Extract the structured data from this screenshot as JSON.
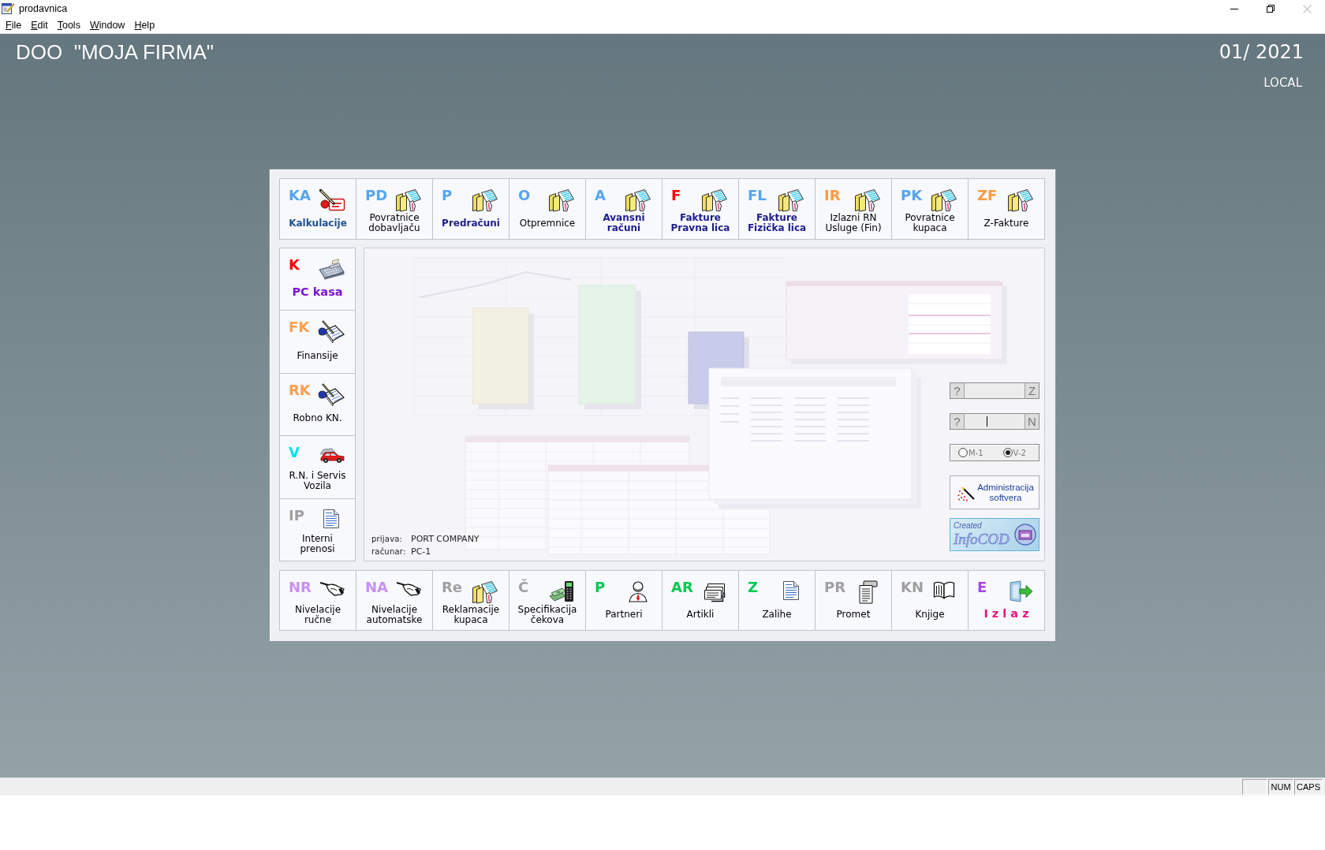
{
  "window": {
    "title": "prodavnica",
    "close_disabled": true
  },
  "menu": [
    "File",
    "Edit",
    "Tools",
    "Window",
    "Help"
  ],
  "header": {
    "company": "DOO  \"MOJA FIRMA\"",
    "period": "01/ 2021",
    "location": "LOCAL"
  },
  "top_modules": [
    {
      "code": "KA",
      "color": "#55a5f0",
      "kind": "pencil-card",
      "label": {
        "text": "Kalkulacije",
        "color": "#1e4f91"
      },
      "bold": true,
      "large": false
    },
    {
      "code": "PD",
      "color": "#55a5f0",
      "kind": "folder",
      "label": {
        "text": "Povratnice\ndobavljaču",
        "color": "#000000"
      },
      "bold": false,
      "large": false
    },
    {
      "code": "P",
      "color": "#55a5f0",
      "kind": "folder",
      "label": {
        "text": "Predračuni",
        "color": "#1c1c8c"
      },
      "bold": true,
      "large": false
    },
    {
      "code": "O",
      "color": "#55a5f0",
      "kind": "folder",
      "label": {
        "text": "Otpremnice",
        "color": "#000000"
      },
      "bold": false,
      "large": false
    },
    {
      "code": "A",
      "color": "#55a5f0",
      "kind": "folder",
      "label": {
        "text": "Avansni\nračuni",
        "color": "#1c1c8c"
      },
      "bold": true,
      "large": false
    },
    {
      "code": "F",
      "color": "#ff0000",
      "kind": "folder",
      "label": {
        "text": "Fakture\nPravna lica",
        "color": "#1c1c8c"
      },
      "bold": true,
      "large": false
    },
    {
      "code": "FL",
      "color": "#55a5f0",
      "kind": "folder",
      "label": {
        "text": "Fakture\nFizička lica",
        "color": "#1c1c8c"
      },
      "bold": true,
      "large": false
    },
    {
      "code": "IR",
      "color": "#ff9a40",
      "kind": "folder",
      "label": {
        "text": "Izlazni RN\nUsluge (Fin)",
        "color": "#000000"
      },
      "bold": false,
      "large": false
    },
    {
      "code": "PK",
      "color": "#55a5f0",
      "kind": "folder",
      "label": {
        "text": "Povratnice\nkupaca",
        "color": "#000000"
      },
      "bold": false,
      "large": false
    },
    {
      "code": "ZF",
      "color": "#ff9a40",
      "kind": "folder",
      "label": {
        "text": "Z-Fakture",
        "color": "#000000"
      },
      "bold": false,
      "large": false
    }
  ],
  "side_modules": [
    {
      "code": "K",
      "color": "#ff0000",
      "kind": "register",
      "label": {
        "text": "PC kasa",
        "color": "#7a14d2"
      },
      "bold": true,
      "large": true
    },
    {
      "code": "FK",
      "color": "#ffa050",
      "kind": "notepad",
      "label": {
        "text": "Finansije",
        "color": "#000000"
      },
      "bold": false,
      "large": false
    },
    {
      "code": "RK",
      "color": "#ffa050",
      "kind": "notepad",
      "label": {
        "text": "Robno KN.",
        "color": "#000000"
      },
      "bold": false,
      "large": false
    },
    {
      "code": "V",
      "color": "#00e4ee",
      "kind": "car",
      "label": {
        "text": "R.N. i Servis\nVozila",
        "color": "#000000"
      },
      "bold": false,
      "large": false
    },
    {
      "code": "IP",
      "color": "#a0a0a0",
      "kind": "document",
      "label": {
        "text": "Interni\nprenosi",
        "color": "#000000"
      },
      "bold": false,
      "large": false
    }
  ],
  "bottom_modules": [
    {
      "code": "NR",
      "color": "#c890f0",
      "kind": "hand-pen",
      "label": {
        "text": "Nivelacije\nručne",
        "color": "#000000"
      },
      "bold": false,
      "large": false
    },
    {
      "code": "NA",
      "color": "#c890f0",
      "kind": "hand-pen",
      "label": {
        "text": "Nivelacije\nautomatske",
        "color": "#000000"
      },
      "bold": false,
      "large": false
    },
    {
      "code": "Re",
      "color": "#a0a0a0",
      "kind": "folder",
      "label": {
        "text": "Reklamacije\nkupaca",
        "color": "#000000"
      },
      "bold": false,
      "large": false
    },
    {
      "code": "Č",
      "color": "#a0a0a0",
      "kind": "cash-calc",
      "label": {
        "text": "Specifikacija\nčekova",
        "color": "#000000"
      },
      "bold": false,
      "large": false
    },
    {
      "code": "P",
      "color": "#00c853",
      "kind": "person",
      "label": {
        "text": "Partneri",
        "color": "#000000"
      },
      "bold": false,
      "large": false
    },
    {
      "code": "AR",
      "color": "#00c853",
      "kind": "cards",
      "label": {
        "text": "Artikli",
        "color": "#000000"
      },
      "bold": false,
      "large": false
    },
    {
      "code": "Z",
      "color": "#00c853",
      "kind": "document",
      "label": {
        "text": "Zalihe",
        "color": "#000000"
      },
      "bold": false,
      "large": false
    },
    {
      "code": "PR",
      "color": "#a0a0a0",
      "kind": "printout",
      "label": {
        "text": "Promet",
        "color": "#000000"
      },
      "bold": false,
      "large": false
    },
    {
      "code": "KN",
      "color": "#a0a0a0",
      "kind": "book",
      "label": {
        "text": "Knjige",
        "color": "#000000"
      },
      "bold": false,
      "large": false
    },
    {
      "code": "E",
      "color": "#a845e8",
      "kind": "exit",
      "label": {
        "text": "I z l a z",
        "color": "#e8147c"
      },
      "bold": true,
      "large": true
    }
  ],
  "login": [
    {
      "label": "prijava:",
      "value": "PORT COMPANY"
    },
    {
      "label": "računar:",
      "value": "PC-1"
    }
  ],
  "lookups": [
    {
      "button": "?",
      "suffix": "Z",
      "focused": false
    },
    {
      "button": "?",
      "suffix": "N",
      "focused": true
    }
  ],
  "mode_options": {
    "disabled": true,
    "options": [
      {
        "label": "M-1",
        "selected": false
      },
      {
        "label": "V-2",
        "selected": true
      }
    ]
  },
  "admin_button": {
    "label": "Administracija softvera"
  },
  "logo": {
    "caption": "Created",
    "name": "InfoCOD"
  },
  "status_bar": {
    "indicators": [
      "NUM",
      "CAPS"
    ]
  }
}
